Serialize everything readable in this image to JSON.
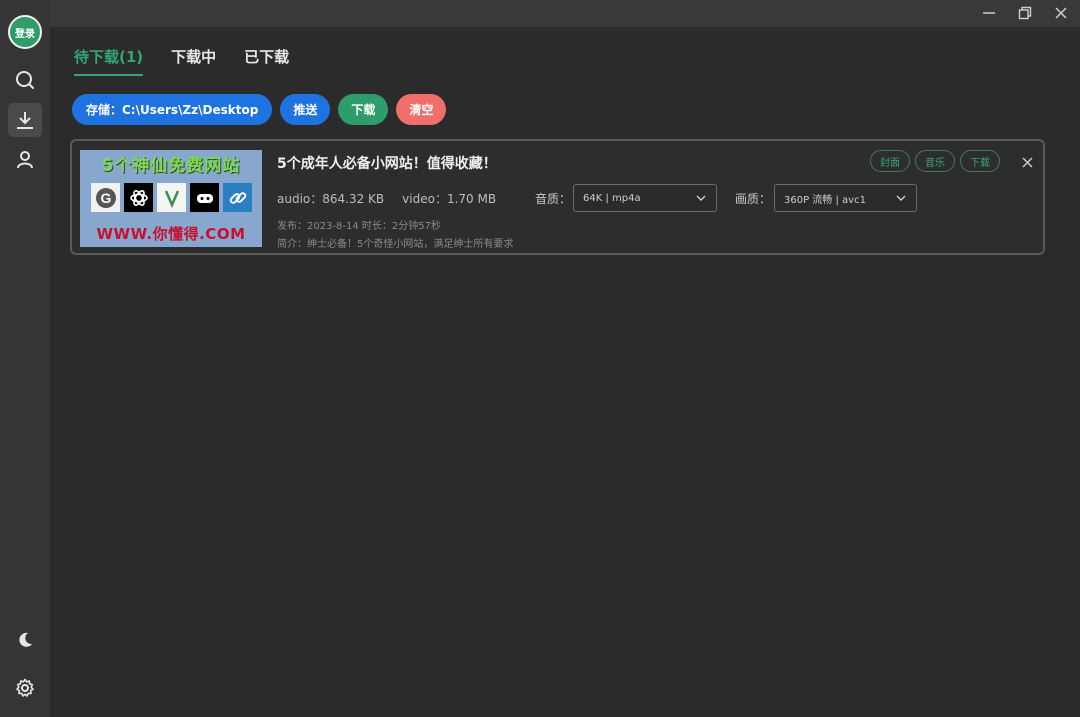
{
  "sidebar": {
    "login_label": "登录",
    "items": [
      {
        "icon": "search-icon"
      },
      {
        "icon": "download-icon",
        "active": true
      },
      {
        "icon": "user-icon"
      }
    ],
    "bottom": [
      {
        "icon": "moon-icon"
      },
      {
        "icon": "gear-icon"
      }
    ]
  },
  "window_controls": [
    "minimize-icon",
    "restore-icon",
    "close-icon"
  ],
  "tabs": [
    {
      "label": "待下载(1)",
      "active": true
    },
    {
      "label": "下载中",
      "active": false
    },
    {
      "label": "已下载",
      "active": false
    }
  ],
  "actions": {
    "storage_label": "存储：C:\\Users\\Zz\\Desktop",
    "push_label": "推送",
    "download_label": "下载",
    "clear_label": "清空"
  },
  "item": {
    "title": "5个成年人必备小网站！值得收藏！",
    "audio_size": "audio：864.32 KB",
    "video_size": "video：1.70 MB",
    "audio_quality_label": "音质：",
    "audio_quality_value": "64K | mp4a",
    "video_quality_label": "画质：",
    "video_quality_value": "360P 流畅 | avc1",
    "publish_info": "发布：2023-8-14 时长：2分钟57秒",
    "description": "简介：绅士必备！5个奇怪小网站，满足绅士所有要求",
    "tags": [
      "封面",
      "音乐",
      "下载"
    ],
    "thumbnail": {
      "headline": "5个神仙免费网站",
      "url_text": "WWW.你懂得.COM"
    }
  },
  "colors": {
    "accent": "#36a574",
    "blue": "#1f73e0",
    "red": "#f06f6b",
    "bg": "#2b2b2b"
  }
}
